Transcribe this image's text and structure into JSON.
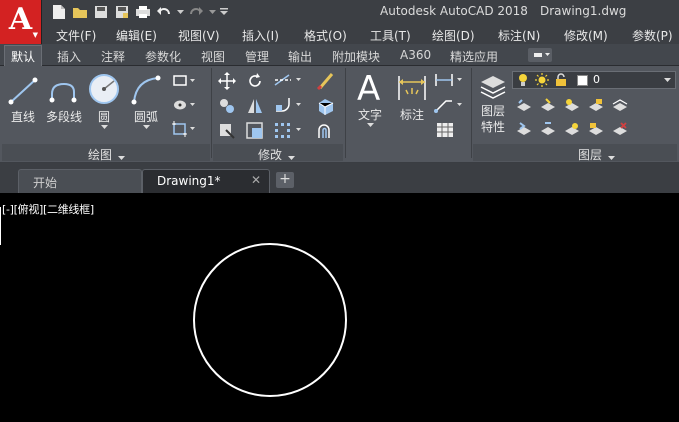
{
  "app": {
    "title": "Autodesk AutoCAD 2018",
    "document": "Drawing1.dwg",
    "logo_letter": "A",
    "accent": "#d32222"
  },
  "menubar": {
    "items": [
      "文件(F)",
      "编辑(E)",
      "视图(V)",
      "插入(I)",
      "格式(O)",
      "工具(T)",
      "绘图(D)",
      "标注(N)",
      "修改(M)",
      "参数(P)"
    ]
  },
  "ribbon": {
    "tabs": [
      "默认",
      "插入",
      "注释",
      "参数化",
      "视图",
      "管理",
      "输出",
      "附加模块",
      "A360",
      "精选应用"
    ],
    "active_tab": "默认",
    "draw_panel": {
      "title": "绘图",
      "tools": [
        "直线",
        "多段线",
        "圆",
        "圆弧"
      ]
    },
    "modify_panel": {
      "title": "修改"
    },
    "annotation": {
      "text_label": "文字",
      "dim_label": "标注"
    },
    "layers_panel": {
      "title": "图层",
      "properties_label_1": "图层",
      "properties_label_2": "特性",
      "current_layer": "0"
    }
  },
  "filetabs": {
    "tabs": [
      {
        "label": "开始",
        "active": false
      },
      {
        "label": "Drawing1*",
        "active": true
      }
    ],
    "close_glyph": "✕",
    "add_glyph": "+"
  },
  "canvas": {
    "viewport_label": "[-][俯视][二维线框]",
    "background": "#000000",
    "entity": "circle"
  }
}
